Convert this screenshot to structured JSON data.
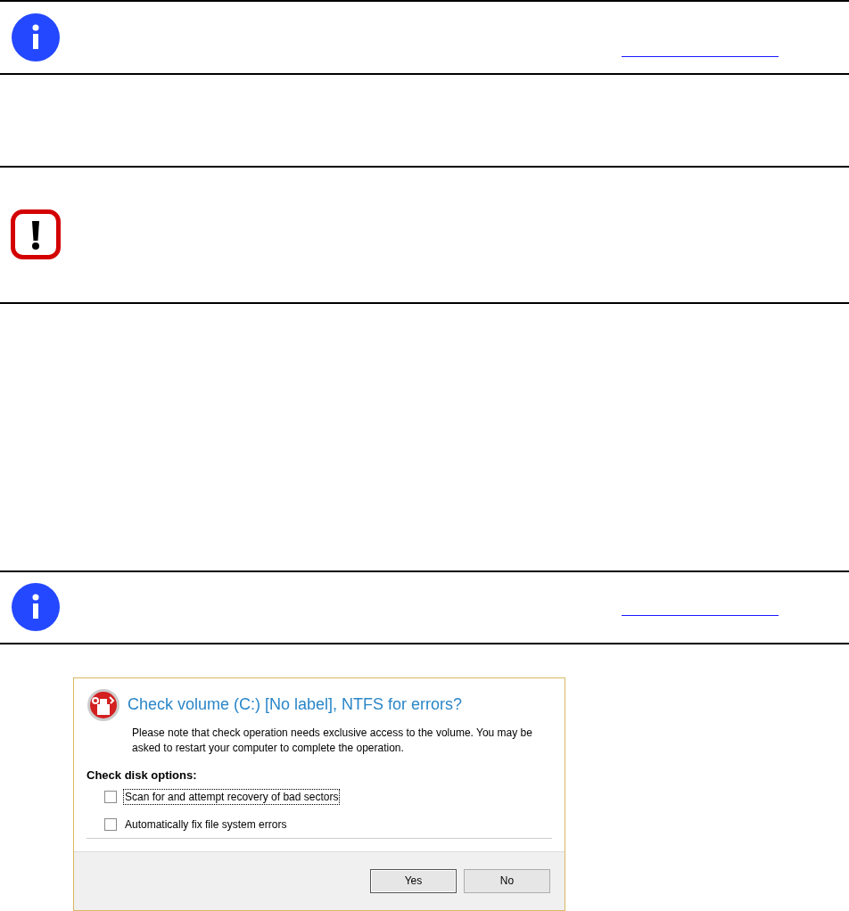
{
  "notes": [
    {
      "kind": "info",
      "link": true
    },
    {
      "kind": "blank"
    },
    {
      "kind": "warning",
      "link": false
    },
    {
      "kind": "blank"
    },
    {
      "kind": "info",
      "link": true
    }
  ],
  "dialog": {
    "title": "Check volume (C:) [No label], NTFS for errors?",
    "message": "Please note that check operation needs exclusive access to the volume. You may be asked to restart your computer to complete the operation.",
    "options_heading": "Check disk options:",
    "options": [
      {
        "label": "Scan for and attempt recovery of bad sectors",
        "checked": false,
        "focused": true
      },
      {
        "label": "Automatically fix file system errors",
        "checked": false,
        "focused": false
      }
    ],
    "buttons": [
      {
        "label": "Yes",
        "default": true
      },
      {
        "label": "No",
        "default": false
      }
    ]
  }
}
